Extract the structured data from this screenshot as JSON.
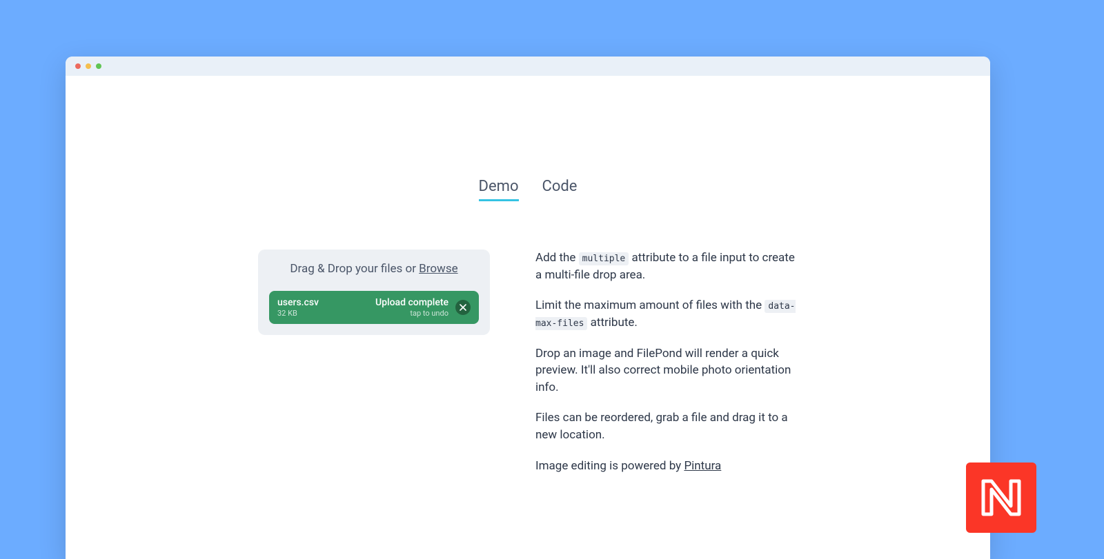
{
  "tabs": {
    "demo": "Demo",
    "code": "Code"
  },
  "dropzone": {
    "label_prefix": "Drag & Drop your files or ",
    "browse": "Browse"
  },
  "file": {
    "name": "users.csv",
    "size": "32 KB",
    "status": "Upload complete",
    "sub": "tap to undo"
  },
  "copy": {
    "p1a": "Add the ",
    "p1_code": "multiple",
    "p1b": " attribute to a file input to create a multi-file drop area.",
    "p2a": "Limit the maximum amount of files with the ",
    "p2_code": "data-max-files",
    "p2b": " attribute.",
    "p3": "Drop an image and FilePond will render a quick preview. It'll also correct mobile photo orientation info.",
    "p4": "Files can be reordered, grab a file and drag it to a new location.",
    "p5a": "Image editing is powered by ",
    "p5_link": "Pintura"
  }
}
